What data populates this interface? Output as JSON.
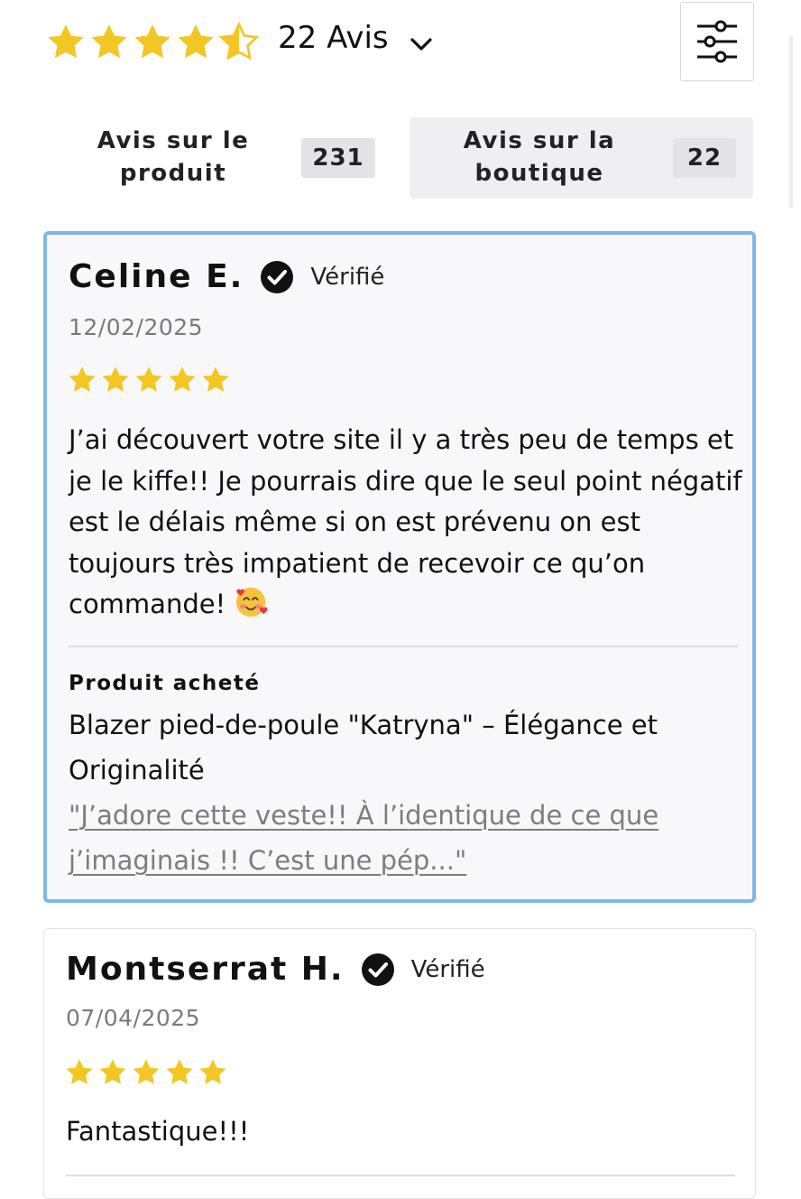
{
  "colors": {
    "star": "#f3c623",
    "accent_border": "#7fb6ea",
    "tab_active_bg": "#efeff1"
  },
  "summary": {
    "rating": 4.5,
    "rating_max": 5,
    "count_label": "22 Avis"
  },
  "filter": {
    "icon": "sliders-icon"
  },
  "tabs": [
    {
      "label": "Avis sur le produit",
      "count": "231"
    },
    {
      "label": "Avis sur la boutique",
      "count": "22"
    }
  ],
  "reviews": [
    {
      "name": "Celine E.",
      "verified_label": "Vérifié",
      "date": "12/02/2025",
      "rating": 5,
      "body": "J’ai découvert votre site il y a très peu de temps et je le kiffe!! Je pourrais dire que le seul point négatif est le délais même si on est prévenu on est toujours très impatient de recevoir ce qu’on commande!",
      "emoji": "smiling-face-with-hearts",
      "product_heading": "Produit acheté",
      "product_name": "Blazer pied-de-poule \"Katryna\" – Élégance et Originalité",
      "product_quote": "\"J’adore cette veste!! À l’identique de ce que j’imaginais !! C’est une pép...\""
    },
    {
      "name": "Montserrat H.",
      "verified_label": "Vérifié",
      "date": "07/04/2025",
      "rating": 5,
      "body": "Fantastique!!!"
    }
  ]
}
